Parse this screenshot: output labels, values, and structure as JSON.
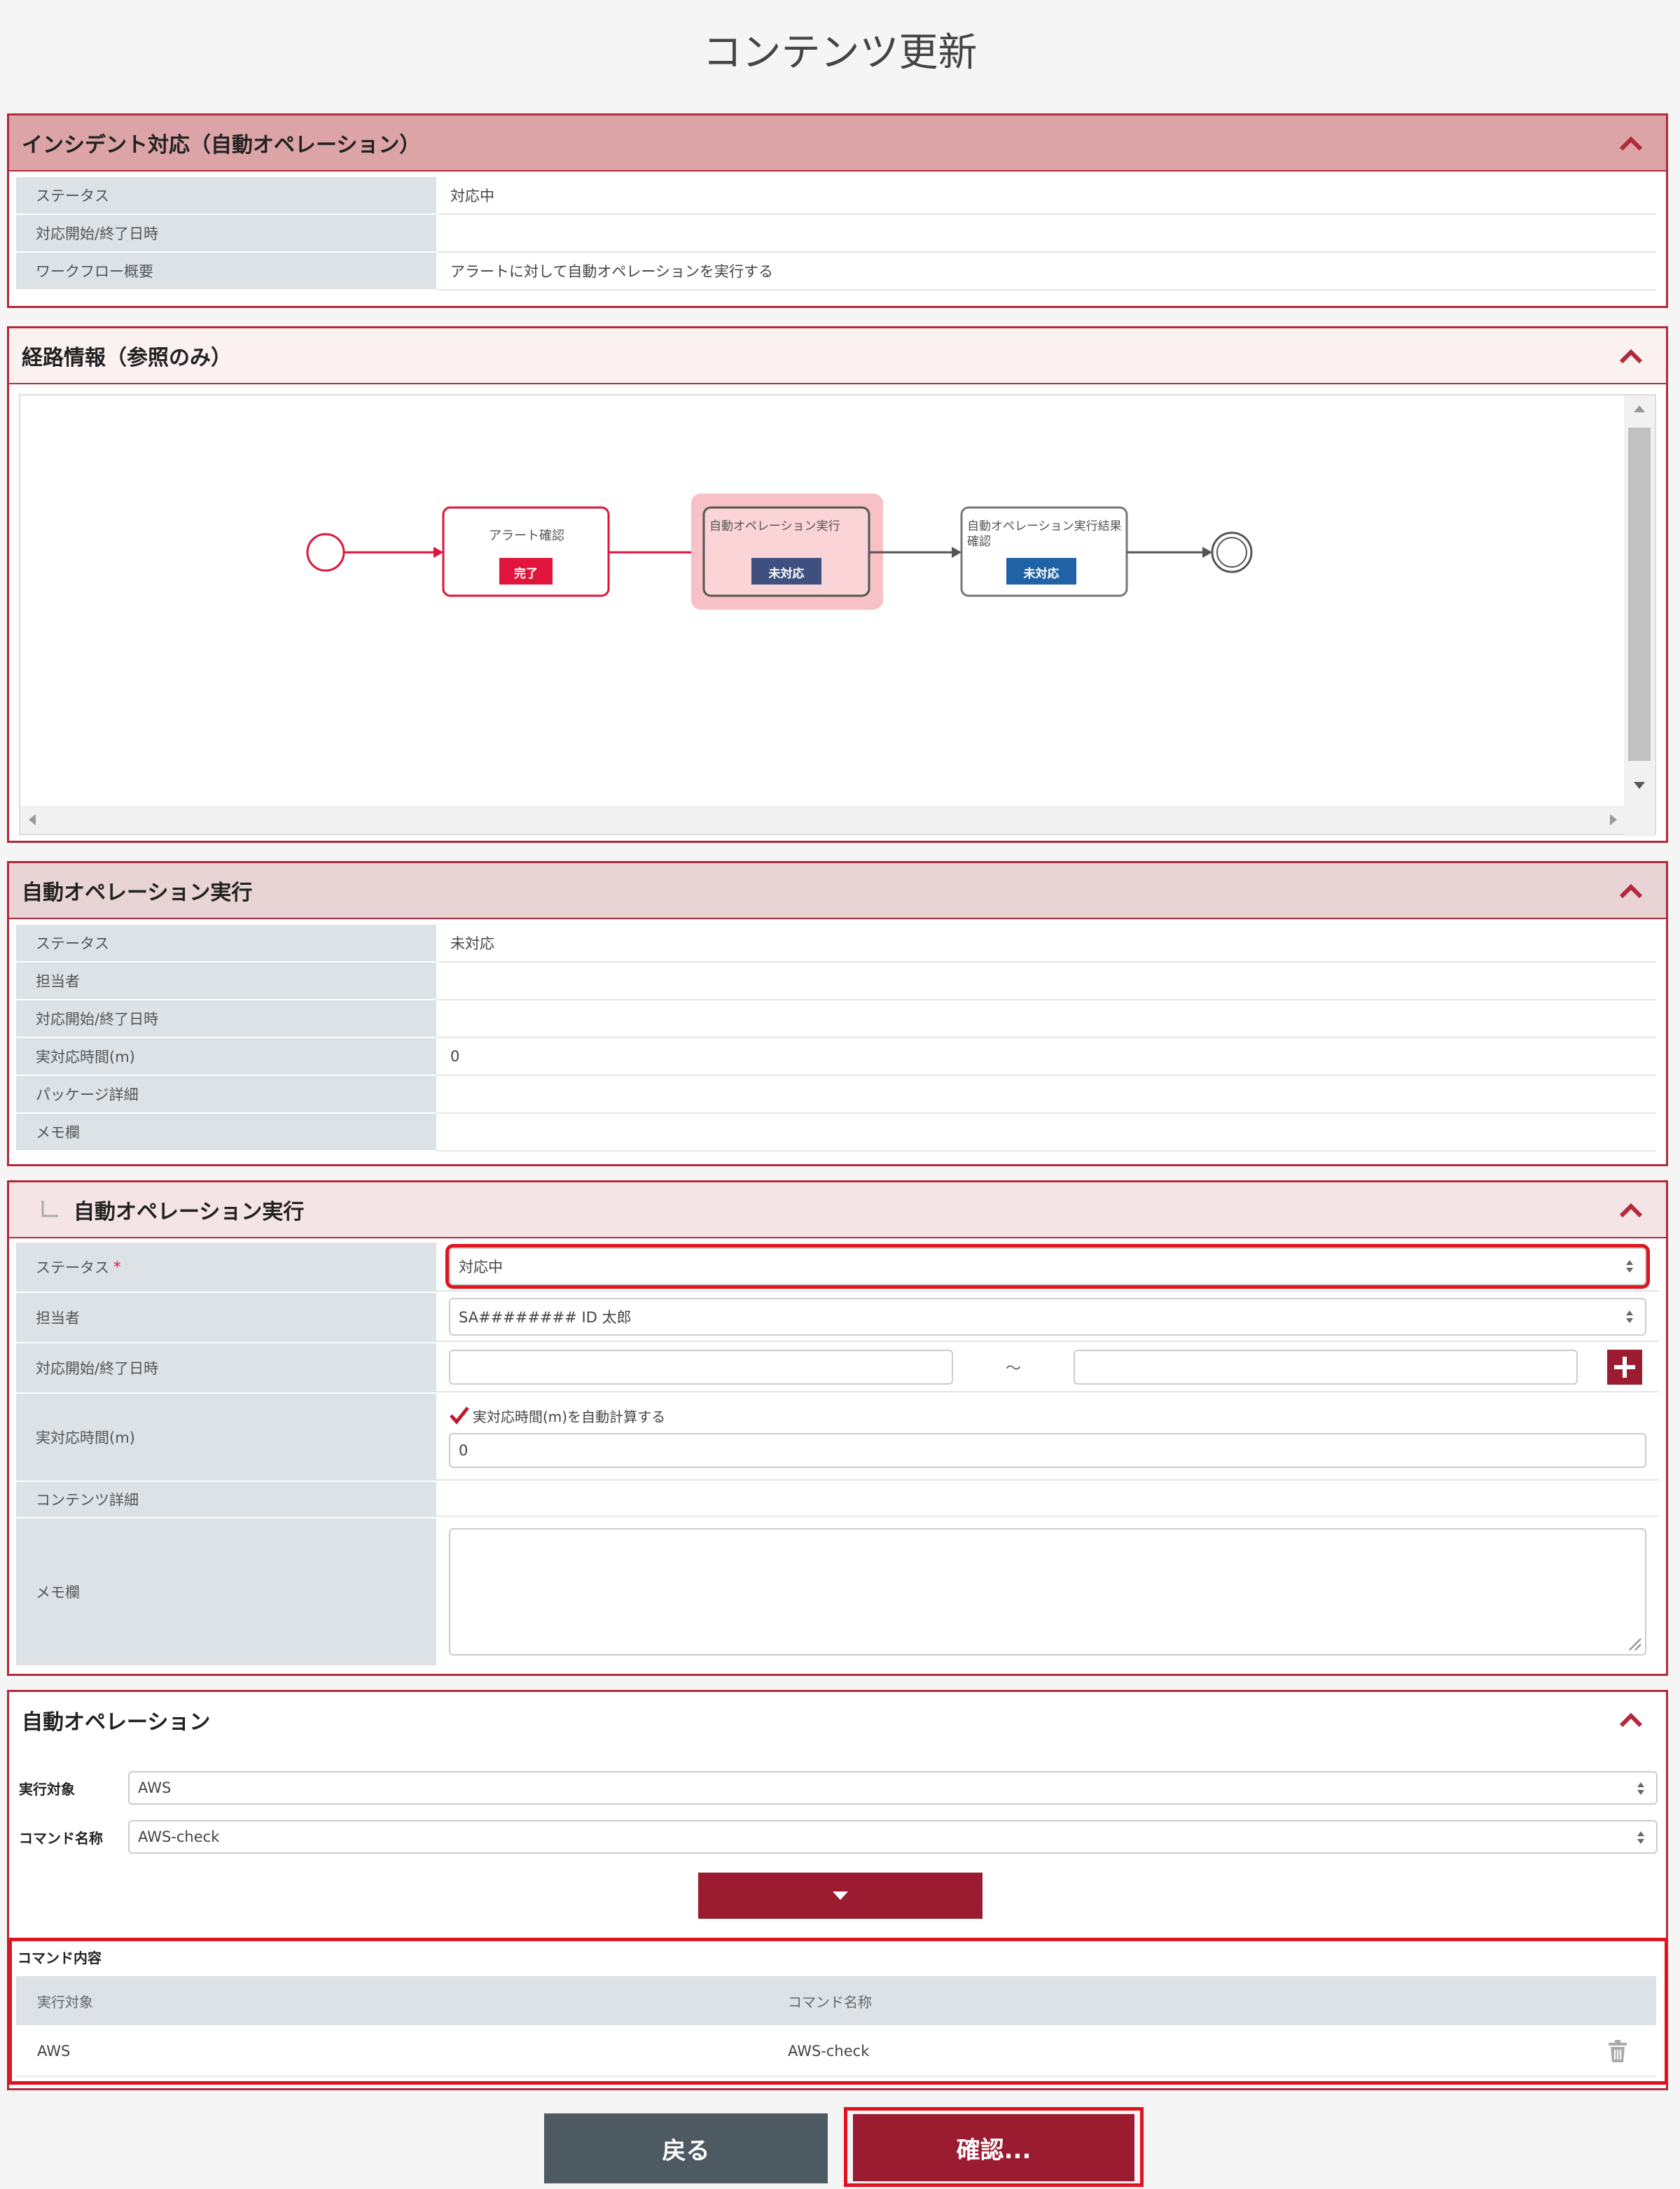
{
  "page": {
    "title": "コンテンツ更新"
  },
  "incident": {
    "header": "インシデント対応（自動オペレーション）",
    "rows": [
      {
        "label": "ステータス",
        "value": "対応中"
      },
      {
        "label": "対応開始/終了日時",
        "value": ""
      },
      {
        "label": "ワークフロー概要",
        "value": "アラートに対して自動オペレーションを実行する"
      }
    ]
  },
  "route": {
    "header": "経路情報（参照のみ）",
    "nodes": [
      {
        "title": "アラート確認",
        "badge": "完了"
      },
      {
        "title": "自動オペレーション実行",
        "badge": "未対応"
      },
      {
        "title": "自動オペレーション実行結果確認",
        "badge": "未対応"
      }
    ]
  },
  "auto_exec_view": {
    "header": "自動オペレーション実行",
    "rows": [
      {
        "label": "ステータス",
        "value": "未対応"
      },
      {
        "label": "担当者",
        "value": ""
      },
      {
        "label": "対応開始/終了日時",
        "value": ""
      },
      {
        "label": "実対応時間(m)",
        "value": "0"
      },
      {
        "label": "パッケージ詳細",
        "value": ""
      },
      {
        "label": "メモ欄",
        "value": ""
      }
    ]
  },
  "auto_exec_edit": {
    "header": "自動オペレーション実行",
    "status_label": "ステータス",
    "required_mark": "*",
    "status_value": "対応中",
    "assignee_label": "担当者",
    "assignee_value": "SA######## ID 太郎",
    "datetime_label": "対応開始/終了日時",
    "datetime_sep": "～",
    "time_label": "実対応時間(m)",
    "auto_calc_label": "実対応時間(m)を自動計算する",
    "time_value": "0",
    "content_label": "コンテンツ詳細",
    "memo_label": "メモ欄"
  },
  "auto_op": {
    "header": "自動オペレーション",
    "target_label": "実行対象",
    "target_value": "AWS",
    "command_label": "コマンド名称",
    "command_value": "AWS-check",
    "content_title": "コマンド内容",
    "table_headers": [
      "実行対象",
      "コマンド名称"
    ],
    "table_rows": [
      [
        "AWS",
        "AWS-check"
      ]
    ]
  },
  "buttons": {
    "back": "戻る",
    "confirm": "確認..."
  },
  "colors": {
    "accent": "#9b1c30",
    "done": "#e0143c",
    "pending": "#3e4f80",
    "pending_blue": "#1f62a5"
  }
}
